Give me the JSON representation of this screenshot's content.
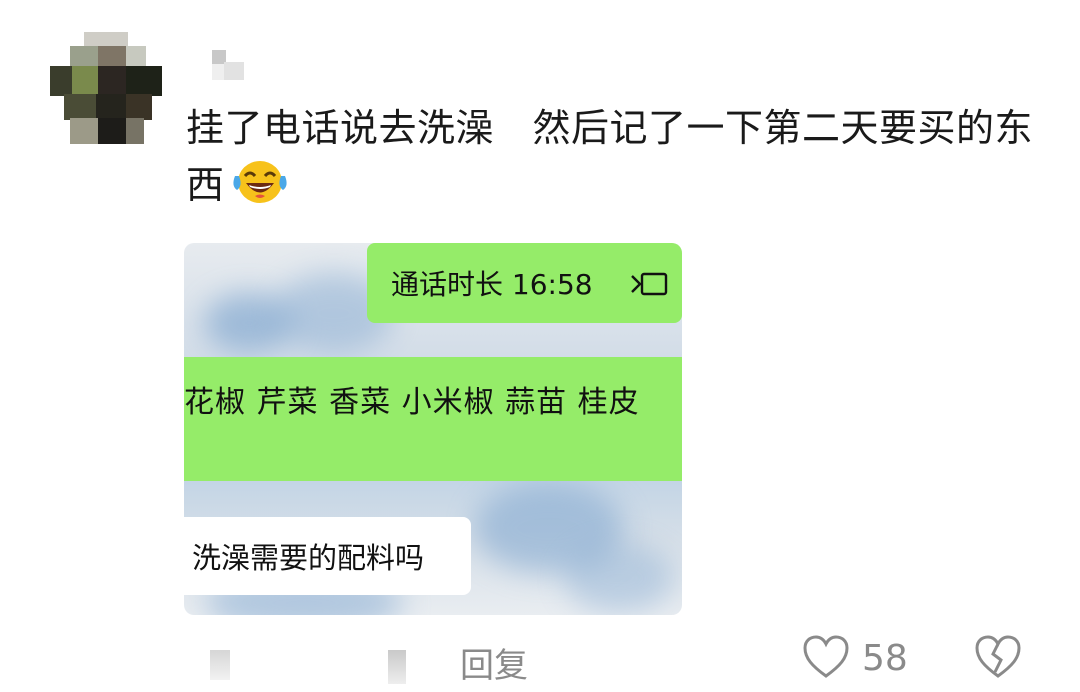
{
  "comment": {
    "text": "挂了电话说去洗澡　然后记了一下第二天要买的东西",
    "emoji": "laughing-crying-emoji"
  },
  "attached_screenshot": {
    "call_bubble": {
      "label": "通话时长 16:58",
      "icon": "video-call-icon"
    },
    "list_bubble": {
      "text": "花椒  芹菜  香菜  小米椒  蒜苗  桂皮"
    },
    "reply_bubble": {
      "text": "洗澡需要的配料吗"
    }
  },
  "actions": {
    "reply_label": "回复",
    "like_count": "58",
    "like_icon": "heart-outline-icon",
    "dislike_icon": "broken-heart-icon"
  },
  "colors": {
    "chat_green": "#95ec69",
    "muted_gray": "#8a8a8a"
  }
}
